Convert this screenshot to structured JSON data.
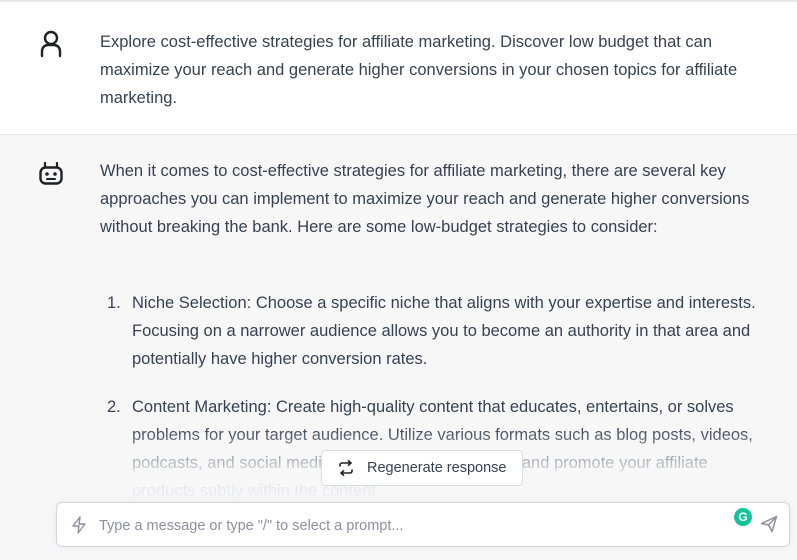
{
  "user_message": {
    "text": "Explore cost-effective strategies for affiliate marketing. Discover low budget that can maximize your reach and generate higher conversions in your chosen topics for affiliate marketing."
  },
  "assistant_message": {
    "intro": "When it comes to cost-effective strategies for affiliate marketing, there are several key approaches you can implement to maximize your reach and generate higher conversions without breaking the bank. Here are some low-budget strategies to consider:",
    "items": [
      {
        "number": "1.",
        "text": "Niche Selection: Choose a specific niche that aligns with your expertise and interests. Focusing on a narrower audience allows you to become an authority in that area and potentially have higher conversion rates."
      },
      {
        "number": "2.",
        "text": "Content Marketing: Create high-quality content that educates, entertains, or solves problems for your target audience. Utilize various formats such as blog posts, videos, podcasts, and social media to engage your audience and promote your affiliate products subtly within the content."
      }
    ]
  },
  "regenerate": {
    "label": "Regenerate response"
  },
  "composer": {
    "placeholder": "Type a message or type \"/\" to select a prompt...",
    "value": "",
    "grammarly_letter": "G"
  },
  "icons": {
    "user": "user-icon",
    "bot": "bot-icon",
    "regenerate": "refresh-icon",
    "bolt": "bolt-icon",
    "send": "send-icon"
  },
  "colors": {
    "assistant_bg": "#f7f7f8",
    "text": "#374151",
    "grammarly": "#15c39a"
  }
}
